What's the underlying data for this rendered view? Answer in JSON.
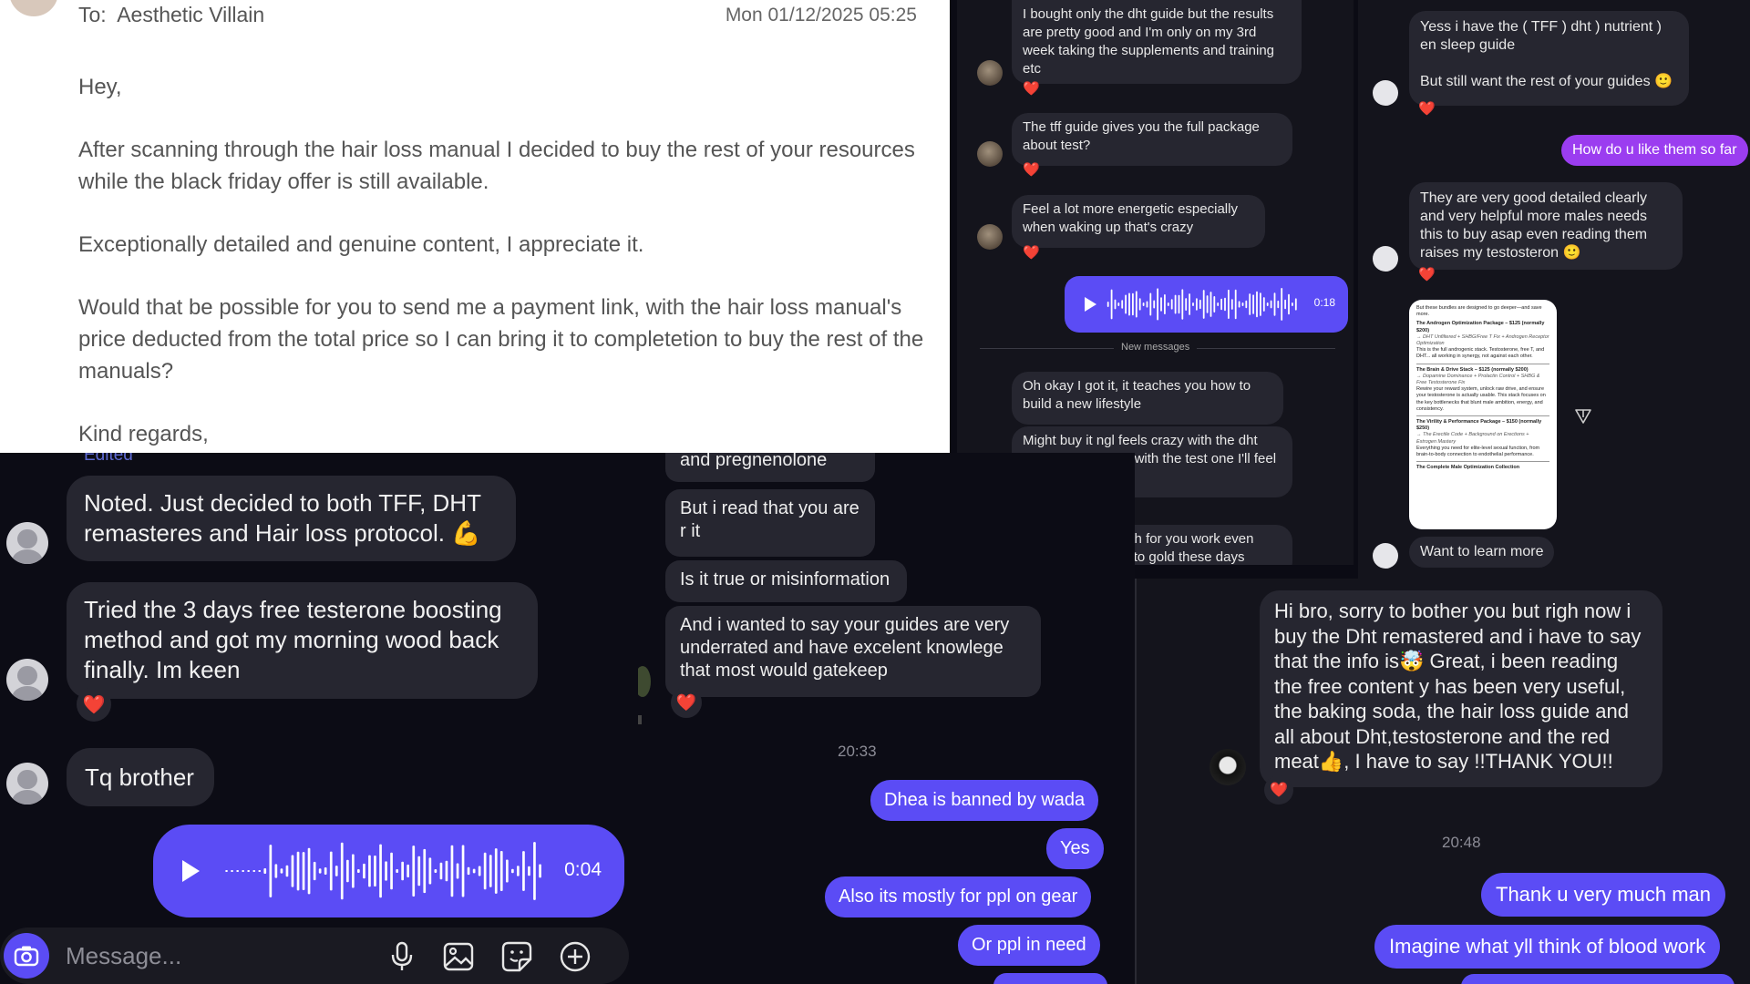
{
  "email": {
    "to_label": "To:",
    "to_name": "Aesthetic Villain",
    "date": "Mon 01/12/2025 05:25",
    "greeting": "Hey,",
    "para1": "After scanning through the hair loss manual I decided to buy the rest of your resources while the black friday offer is still available.",
    "para2": "Exceptionally detailed and genuine content, I appreciate it.",
    "para3": "Would that be possible for you to send me a payment link, with the hair loss manual's price deducted from the total price so I can bring it to completetion to buy the rest of the manuals?",
    "closing": "Kind regards,"
  },
  "chat_bottom_left": {
    "edited": "Edited",
    "msg1": "Noted. Just decided to both TFF, DHT remasteres and Hair loss protocol. 💪",
    "msg2": "Tried the 3 days free testerone boosting method and got my morning wood back finally. Im keen",
    "msg3": "Tq brother",
    "voice_duration": "0:04",
    "message_placeholder": "Message..."
  },
  "chat_middle_bottom": {
    "msg1": "and pregnenolone",
    "msg2": "But i read that you are r it",
    "msg3": "Is it true or misinformation",
    "msg4": "And i wanted to say your guides are very underrated and have excelent knowlege that most would gatekeep",
    "time": "20:33",
    "out1": "Dhea is banned by wada",
    "out2": "Yes",
    "out3": "Also its mostly for ppl on gear",
    "out4": "Or ppl in need"
  },
  "chat_top_middle": {
    "msg1": "I bought only the dht guide but the results are pretty good and I'm only on my 3rd week taking the supplements and training etc",
    "msg2": "The tff guide gives you the full package about test?",
    "msg3": "Feel a lot more energetic especially when waking up that's crazy",
    "voice_duration": "0:18",
    "divider": "New messages",
    "msg4": "Oh okay I got it, it teaches you how to build a new lifestyle",
    "msg5": "Might buy it ngl feels crazy with the dht guide so probably with the test one I'll feel like god😹",
    "msg6": "Thank you so much for you work even your posts equals to gold these days"
  },
  "chat_top_right": {
    "msg1": "Yess i have the ( TFF ) dht ) nutrient ) en sleep guide",
    "msg1b": "But still want the rest of your guides 🙂",
    "out1": "How do u like them so far",
    "msg2": "They are very good detailed clearly and very helpful more males needs this to buy asap even reading them raises my testosteron 🙂",
    "doc": {
      "intro": "But these bundles are designed to go deeper—and save more.",
      "p1_title": "The Androgen Optimization Package – $125 (normally $200)",
      "p1_items": "→ DHT Unfiltered + SHBG/Free T Fix + Androgen Receptor Optimization",
      "p1_desc": "This is the full androgenic stack. Testosterone, free T, and DHT... all working in synergy, not against each other.",
      "p2_title": "The Brain & Drive Stack – $125 (normally $200)",
      "p2_items": "→ Dopamine Dominance + Prolactin Control + SHBG & Free Testosterone Fix",
      "p2_desc": "Rewire your reward system, unlock raw drive, and ensure your testosterone is actually usable. This stack focuses on the key bottlenecks that blunt male ambition, energy, and consistency.",
      "p3_title": "The Virility & Performance Package – $150 (normally $250)",
      "p3_items": "→ The Erectile Code + Background on Erections + Estrogen Mastery",
      "p3_desc": "Everything you need for elite-level sexual function, from brain-to-body connection to endothelial performance.",
      "p4_title": "The Complete Male Optimization Collection"
    },
    "msg3": "Want to learn more"
  },
  "chat_bottom_right": {
    "msg1": "Hi bro, sorry to bother you but righ now i buy the Dht remastered and i have to say that the info is🤯 Great, i been reading the free content y has been very useful, the baking soda, the hair loss guide and all about Dht,testosterone and the red meat👍, I have to say !!THANK YOU!!",
    "time": "20:48",
    "out1": "Thank u very much man",
    "out2": "Imagine what yll think of blood work"
  },
  "colors": {
    "accent_blue": "#5b4cf5",
    "accent_purple": "#9b3df0",
    "heart_red": "#e0245e",
    "bubble_dark": "#262630"
  },
  "icons": [
    "camera-icon",
    "microphone-icon",
    "image-icon",
    "sticker-icon",
    "plus-icon",
    "play-icon",
    "heart-icon",
    "send-icon"
  ]
}
